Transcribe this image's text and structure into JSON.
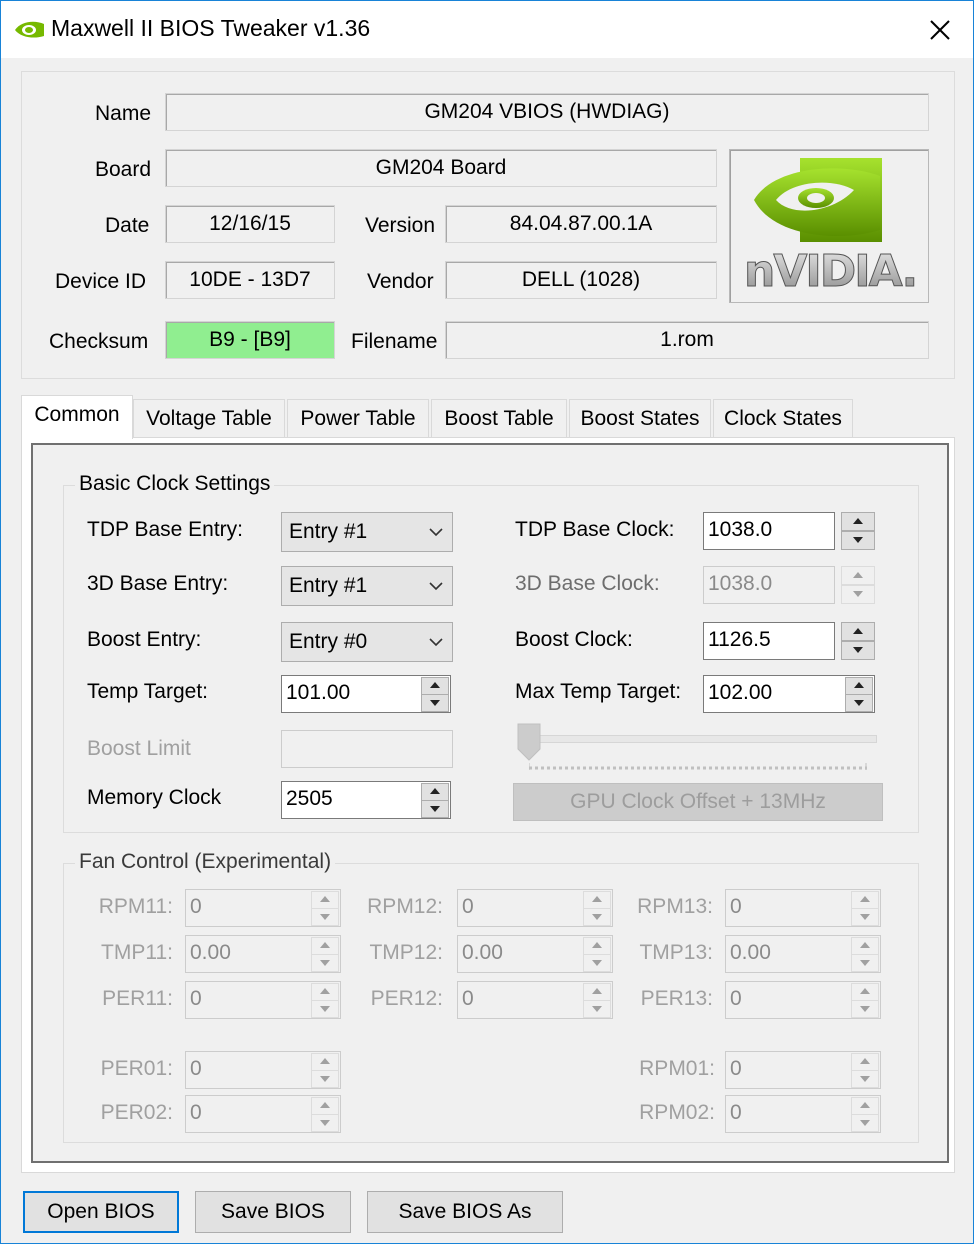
{
  "window": {
    "title": "Maxwell II BIOS Tweaker v1.36"
  },
  "info": {
    "name_label": "Name",
    "name_value": "GM204 VBIOS (HWDIAG)",
    "board_label": "Board",
    "board_value": "GM204 Board",
    "date_label": "Date",
    "date_value": "12/16/15",
    "version_label": "Version",
    "version_value": "84.04.87.00.1A",
    "device_id_label": "Device ID",
    "device_id_value": "10DE - 13D7",
    "vendor_label": "Vendor",
    "vendor_value": "DELL (1028)",
    "checksum_label": "Checksum",
    "checksum_value": "B9 - [B9]",
    "checksum_color": "#90ee90",
    "filename_label": "Filename",
    "filename_value": "1.rom",
    "logo_text": "nVIDIA."
  },
  "tabs": [
    {
      "label": "Common",
      "active": true
    },
    {
      "label": "Voltage Table"
    },
    {
      "label": "Power Table"
    },
    {
      "label": "Boost Table"
    },
    {
      "label": "Boost States"
    },
    {
      "label": "Clock States"
    }
  ],
  "basic": {
    "title": "Basic Clock Settings",
    "tdp_base_entry_label": "TDP Base Entry:",
    "tdp_base_entry_value": "Entry #1",
    "base3d_entry_label": "3D Base Entry:",
    "base3d_entry_value": "Entry #1",
    "boost_entry_label": "Boost Entry:",
    "boost_entry_value": "Entry #0",
    "temp_target_label": "Temp Target:",
    "temp_target_value": "101.00",
    "boost_limit_label": "Boost Limit",
    "boost_limit_value": "",
    "memory_clock_label": "Memory Clock",
    "memory_clock_value": "2505",
    "tdp_base_clock_label": "TDP Base Clock:",
    "tdp_base_clock_value": "1038.0",
    "base3d_clock_label": "3D Base Clock:",
    "base3d_clock_value": "1038.0",
    "boost_clock_label": "Boost Clock:",
    "boost_clock_value": "1126.5",
    "max_temp_target_label": "Max Temp Target:",
    "max_temp_target_value": "102.00",
    "gpu_offset_slider_value": 0,
    "gpu_offset_button": "GPU Clock Offset + 13MHz"
  },
  "fan": {
    "title": "Fan Control (Experimental)",
    "rpm11_label": "RPM11:",
    "rpm11_value": "0",
    "rpm12_label": "RPM12:",
    "rpm12_value": "0",
    "rpm13_label": "RPM13:",
    "rpm13_value": "0",
    "tmp11_label": "TMP11:",
    "tmp11_value": "0.00",
    "tmp12_label": "TMP12:",
    "tmp12_value": "0.00",
    "tmp13_label": "TMP13:",
    "tmp13_value": "0.00",
    "per11_label": "PER11:",
    "per11_value": "0",
    "per12_label": "PER12:",
    "per12_value": "0",
    "per13_label": "PER13:",
    "per13_value": "0",
    "per01_label": "PER01:",
    "per01_value": "0",
    "per02_label": "PER02:",
    "per02_value": "0",
    "rpm01_label": "RPM01:",
    "rpm01_value": "0",
    "rpm02_label": "RPM02:",
    "rpm02_value": "0"
  },
  "buttons": {
    "open": "Open BIOS",
    "save": "Save BIOS",
    "save_as": "Save BIOS As"
  },
  "icons": {
    "app": "nvidia-eye-icon",
    "close": "close-icon",
    "dropdown": "chevron-down-icon",
    "spin": "spin-arrows-icon"
  },
  "colors": {
    "window_border": "#1883d7",
    "nvidia_green": "#76b900",
    "checksum_ok": "#90ee90",
    "focus_blue": "#0078d7"
  }
}
